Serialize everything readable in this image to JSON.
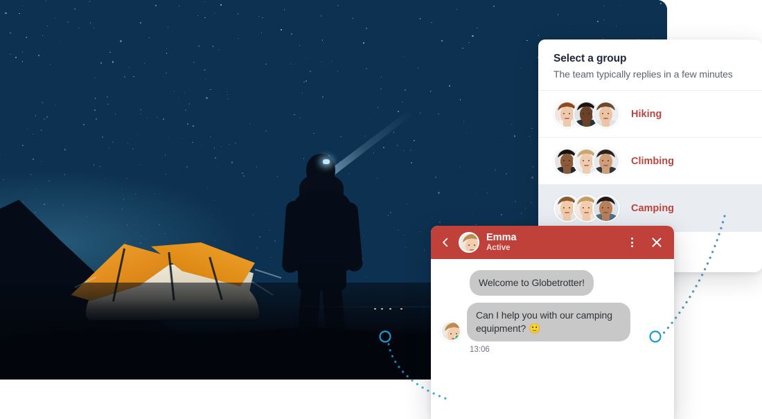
{
  "theme": {
    "accent_red": "#c0413a",
    "link_red": "#b9453f",
    "dot_blue": "#1b9ad6",
    "online_green": "#2cc36b",
    "bubble_gray": "#c8c8c8",
    "row_active_gray": "#e9ecf1"
  },
  "hero": {
    "name": "night-camping-photo",
    "alt": "Silhouette of a person with a headlamp standing beside a lit orange dome tent under a starry night sky"
  },
  "group_panel": {
    "title": "Select a group",
    "subtitle": "The team typically replies in a few minutes",
    "rows": [
      {
        "name": "Hiking",
        "avatar_count": 3,
        "active": false
      },
      {
        "name": "Climbing",
        "avatar_count": 3,
        "active": false
      },
      {
        "name": "Camping",
        "avatar_count": 3,
        "active": true
      },
      {
        "name": "",
        "avatar_count": 0,
        "active": false
      }
    ]
  },
  "chat": {
    "header": {
      "back_icon": "chevron-left-icon",
      "avatar": "emma-avatar",
      "name": "Emma",
      "status": "Active",
      "menu_icon": "kebab-menu-icon",
      "close_icon": "close-icon"
    },
    "messages": [
      {
        "text": "Welcome to Globetrotter!",
        "from": "agent",
        "show_avatar": false,
        "timestamp": ""
      },
      {
        "text": "Can I help you with our camping equipment? 🙂",
        "from": "agent",
        "show_avatar": true,
        "timestamp": "13:06"
      }
    ],
    "timestamp": "13:06"
  },
  "connectors": {
    "left_marker": {
      "label": "hotspot-marker-left"
    },
    "right_marker": {
      "label": "hotspot-marker-right"
    }
  }
}
